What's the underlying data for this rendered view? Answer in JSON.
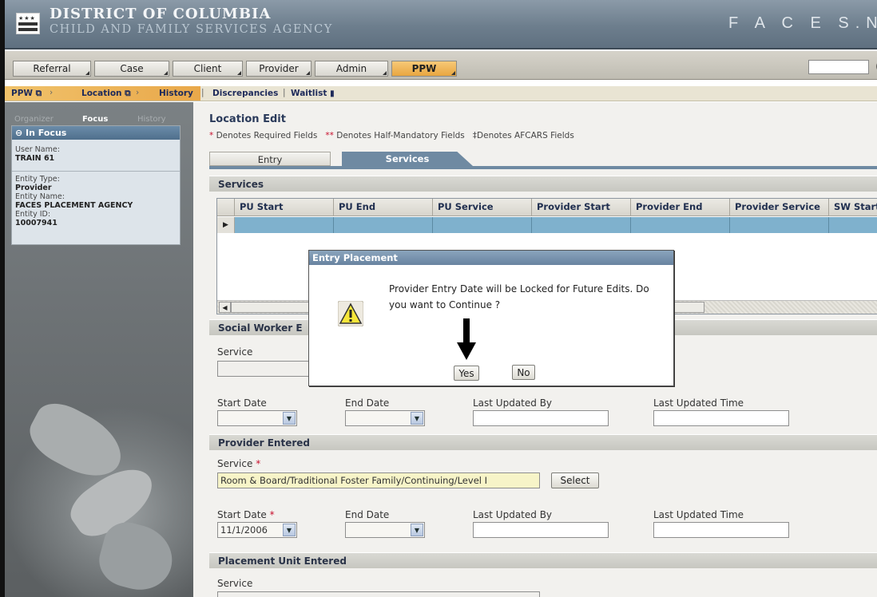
{
  "header": {
    "line1": "DISTRICT OF COLUMBIA",
    "line2": "CHILD AND FAMILY SERVICES AGENCY",
    "app_name": "F A C E S.N E"
  },
  "menu": {
    "items": [
      "Referral",
      "Case",
      "Client",
      "Provider",
      "Admin",
      "PPW"
    ],
    "active": "PPW"
  },
  "breadcrumb": {
    "items": [
      "PPW",
      "Location",
      "History",
      "Discrepancies",
      "Waitlist"
    ]
  },
  "sidebar": {
    "tabs": [
      "Organizer",
      "Focus",
      "History"
    ],
    "active_tab": "Focus",
    "panel_title": "In Focus",
    "user_name_label": "User Name:",
    "user_name": "TRAIN 61",
    "entity_type_label": "Entity Type:",
    "entity_type": "Provider",
    "entity_name_label": "Entity Name:",
    "entity_name": "FACES PLACEMENT AGENCY",
    "entity_id_label": "Entity ID:",
    "entity_id": "10007941"
  },
  "page": {
    "title": "Location Edit",
    "legend_required": "Denotes Required Fields",
    "legend_half": "Denotes Half-Mandatory Fields",
    "legend_afcars": "Denotes AFCARS Fields",
    "req_mark": "*",
    "half_mark": "**",
    "afcars_mark": "‡",
    "tabs": [
      "Entry",
      "Services"
    ],
    "active_tab": "Services"
  },
  "services_grid": {
    "section": "Services",
    "columns": [
      "PU Start",
      "PU End",
      "PU Service",
      "Provider Start",
      "Provider End",
      "Provider Service",
      "SW Start"
    ],
    "rows": [
      [
        "",
        "",
        "",
        "",
        "",
        "",
        ""
      ]
    ]
  },
  "social_worker": {
    "section": "Social Worker E",
    "service_label": "Service",
    "start_label": "Start Date",
    "end_label": "End Date",
    "updated_by_label": "Last Updated By",
    "updated_time_label": "Last Updated Time"
  },
  "provider_entered": {
    "section": "Provider Entered",
    "service_label": "Service",
    "service_value": "Room & Board/Traditional Foster Family/Continuing/Level I",
    "select_label": "Select",
    "start_label": "Start Date",
    "start_value": "11/1/2006",
    "end_label": "End Date",
    "updated_by_label": "Last Updated By",
    "updated_time_label": "Last Updated Time"
  },
  "placement_unit": {
    "section": "Placement Unit Entered",
    "service_label": "Service"
  },
  "dialog": {
    "title": "Entry Placement",
    "message": "Provider Entry Date will be Locked for Future Edits. Do you want to Continue ?",
    "yes": "Yes",
    "no": "No"
  },
  "colors": {
    "accent_orange": "#e9a84a",
    "tab_blue": "#6f8aa2",
    "grid_row_blue": "#7fb1cd",
    "required_red": "#c8102e"
  }
}
